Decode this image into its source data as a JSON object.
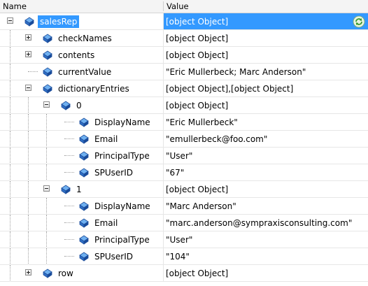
{
  "header": {
    "name_label": "Name",
    "value_label": "Value"
  },
  "rows": [
    {
      "name": "salesRep",
      "value": "[object Object]",
      "depth": 0,
      "expander": "minus",
      "selected": true
    },
    {
      "name": "checkNames",
      "value": "[object Object]",
      "depth": 1,
      "expander": "plus"
    },
    {
      "name": "contents",
      "value": "[object Object]",
      "depth": 1,
      "expander": "plus"
    },
    {
      "name": "currentValue",
      "value": "\"Eric Mullerbeck; Marc Anderson\"",
      "depth": 1,
      "expander": "none"
    },
    {
      "name": "dictionaryEntries",
      "value": "[object Object],[object Object]",
      "depth": 1,
      "expander": "minus"
    },
    {
      "name": "0",
      "value": "[object Object]",
      "depth": 2,
      "expander": "minus"
    },
    {
      "name": "DisplayName",
      "value": "\"Eric Mullerbeck\"",
      "depth": 3,
      "expander": "none"
    },
    {
      "name": "Email",
      "value": "\"emullerbeck@foo.com\"",
      "depth": 3,
      "expander": "none"
    },
    {
      "name": "PrincipalType",
      "value": "\"User\"",
      "depth": 3,
      "expander": "none"
    },
    {
      "name": "SPUserID",
      "value": "\"67\"",
      "depth": 3,
      "expander": "none"
    },
    {
      "name": "1",
      "value": "[object Object]",
      "depth": 2,
      "expander": "minus"
    },
    {
      "name": "DisplayName",
      "value": "\"Marc Anderson\"",
      "depth": 3,
      "expander": "none"
    },
    {
      "name": "Email",
      "value": "\"marc.anderson@sympraxisconsulting.com\"",
      "depth": 3,
      "expander": "none"
    },
    {
      "name": "PrincipalType",
      "value": "\"User\"",
      "depth": 3,
      "expander": "none"
    },
    {
      "name": "SPUserID",
      "value": "\"104\"",
      "depth": 3,
      "expander": "none"
    },
    {
      "name": "row",
      "value": "[object Object]",
      "depth": 1,
      "expander": "plus"
    }
  ],
  "icons": {
    "property": "property-icon",
    "refresh": "refresh-icon"
  },
  "colors": {
    "selection": "#3399ff",
    "icon_blue": "#2f6fc6"
  }
}
